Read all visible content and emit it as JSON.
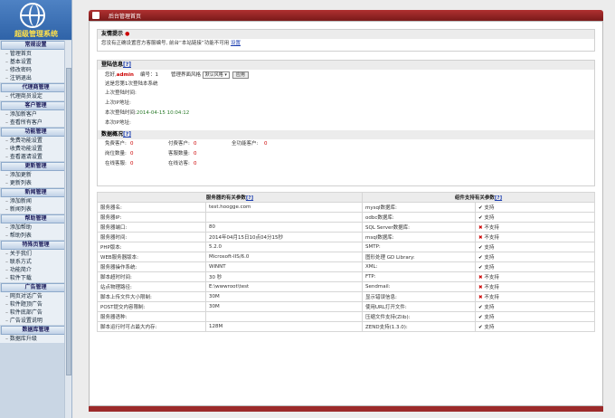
{
  "sidebar": {
    "logo_text": "超级管理系统",
    "sections": [
      {
        "title": "常规设置",
        "items": [
          "管理首页",
          "基本设置",
          "修改密码",
          "注销退出"
        ]
      },
      {
        "title": "代理商管理",
        "items": [
          "代理商员设定"
        ]
      },
      {
        "title": "客户管理",
        "items": [
          "添加新客户",
          "查看所有客户"
        ]
      },
      {
        "title": "功能管理",
        "items": [
          "免费功能设置",
          "收费功能设置",
          "查看邀请设置"
        ]
      },
      {
        "title": "更新管理",
        "items": [
          "添加更新",
          "更新列表"
        ]
      },
      {
        "title": "新闻管理",
        "items": [
          "添加新闻",
          "新闻列表"
        ]
      },
      {
        "title": "帮助管理",
        "items": [
          "添加帮助",
          "帮助列表"
        ]
      },
      {
        "title": "特殊页管理",
        "items": [
          "关于我们",
          "联系方式",
          "功能简介",
          "软件下载"
        ]
      },
      {
        "title": "广告管理",
        "items": [
          "网页对话广告",
          "软件题顶广告",
          "软件底部广告",
          "广告设置说明"
        ]
      },
      {
        "title": "数据库管理",
        "items": [
          "数据库升级"
        ]
      }
    ]
  },
  "topbar": {
    "title": "后台管理首页"
  },
  "notice": {
    "title": "友情提示",
    "text": "您没有正确设置官方客服编号, 前台“本站链接”功能不可用",
    "link": "设置"
  },
  "login": {
    "title": "登陆信息",
    "help": "[?]",
    "greeting_prefix": "您好,",
    "username": "admin",
    "id_label": "编号：",
    "id_value": "1",
    "style_label": "管理界面风格",
    "style_value": "默认风格",
    "apply_label": "应用",
    "visit_text": "这是您第1次登陆本系统",
    "last_time_label": "上次登陆时间:",
    "last_ip_label": "上次IP地址:",
    "this_time_label": "本次登陆时间:",
    "this_time_value": "2014-04-15 10:04:12",
    "this_ip_label": "本次IP地址:"
  },
  "stats": {
    "title": "数据概况",
    "help": "[?]",
    "rows": [
      [
        "免费客户:",
        "0",
        "付费客户:",
        "0",
        "全功能客户:",
        "0"
      ],
      [
        "岗位数量:",
        "0",
        "客服数量:",
        "0"
      ],
      [
        "在线客服:",
        "0",
        "在线访客:",
        "0"
      ]
    ]
  },
  "server": {
    "left_header": "服务器的有关参数",
    "right_header": "组件支持有关参数",
    "help": "[?]",
    "rows": [
      {
        "k": "服务器名:",
        "v": "test.hoogge.com",
        "c": "mysql数据库:",
        "s": "支持",
        "ok": true
      },
      {
        "k": "服务器IP:",
        "v": "",
        "c": "odbc数据库:",
        "s": "支持",
        "ok": true
      },
      {
        "k": "服务器端口:",
        "v": "80",
        "c": "SQL Server数据库:",
        "s": "不支持",
        "ok": false
      },
      {
        "k": "服务器时间:",
        "v": "2014年04月15日10点04分15秒",
        "c": "msql数据库:",
        "s": "不支持",
        "ok": false
      },
      {
        "k": "PHP版本:",
        "v": "5.2.0",
        "c": "SMTP:",
        "s": "支持",
        "ok": true
      },
      {
        "k": "WEB服务器版本:",
        "v": "Microsoft-IIS/6.0",
        "c": "图形处理 GD Library:",
        "s": "支持",
        "ok": true
      },
      {
        "k": "服务器操作系统:",
        "v": "WINNT",
        "c": "XML:",
        "s": "支持",
        "ok": true
      },
      {
        "k": "脚本超时时间:",
        "v": "30 秒",
        "c": "FTP:",
        "s": "不支持",
        "ok": false
      },
      {
        "k": "站点物理路径:",
        "v": "E:\\wwwroot\\test",
        "c": "Sendmail:",
        "s": "不支持",
        "ok": false
      },
      {
        "k": "脚本上传文件大小限制:",
        "v": "30M",
        "c": "显示错误信息:",
        "s": "不支持",
        "ok": false
      },
      {
        "k": "POST提交内容限制:",
        "v": "30M",
        "c": "使用URL打开文件:",
        "s": "支持",
        "ok": true
      },
      {
        "k": "服务器语种:",
        "v": "",
        "c": "压缩文件支持(Zlib):",
        "s": "支持",
        "ok": true
      },
      {
        "k": "脚本运行时可占最大内存:",
        "v": "128M",
        "c": "ZEND支持(1.3.0):",
        "s": "支持",
        "ok": true
      }
    ]
  }
}
